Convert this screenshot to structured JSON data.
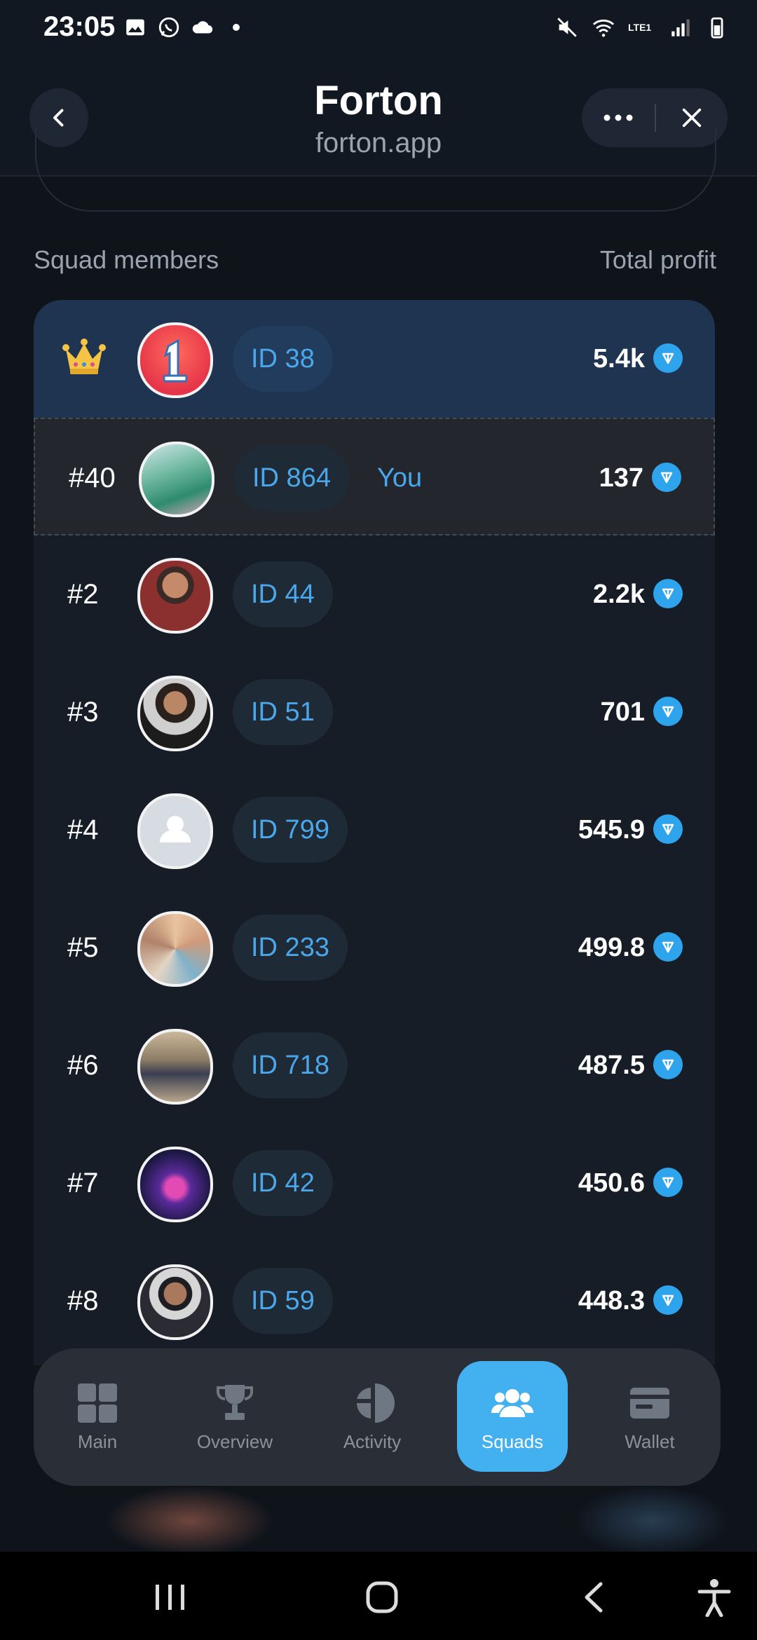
{
  "status_bar": {
    "time": "23:05",
    "network": "LTE1"
  },
  "header": {
    "title": "Forton",
    "subtitle": "forton.app"
  },
  "section": {
    "left_label": "Squad members",
    "right_label": "Total profit"
  },
  "members": [
    {
      "rank": "",
      "id": "ID 38",
      "profit": "5.4k",
      "you": "",
      "highlight": "first"
    },
    {
      "rank": "#40",
      "id": "ID 864",
      "profit": "137",
      "you": "You",
      "highlight": "you"
    },
    {
      "rank": "#2",
      "id": "ID 44",
      "profit": "2.2k",
      "you": ""
    },
    {
      "rank": "#3",
      "id": "ID 51",
      "profit": "701",
      "you": ""
    },
    {
      "rank": "#4",
      "id": "ID 799",
      "profit": "545.9",
      "you": ""
    },
    {
      "rank": "#5",
      "id": "ID 233",
      "profit": "499.8",
      "you": ""
    },
    {
      "rank": "#6",
      "id": "ID 718",
      "profit": "487.5",
      "you": ""
    },
    {
      "rank": "#7",
      "id": "ID 42",
      "profit": "450.6",
      "you": ""
    },
    {
      "rank": "#8",
      "id": "ID 59",
      "profit": "448.3",
      "you": ""
    }
  ],
  "nav": {
    "items": [
      {
        "label": "Main",
        "icon": "grid-icon"
      },
      {
        "label": "Overview",
        "icon": "trophy-icon"
      },
      {
        "label": "Activity",
        "icon": "pie-chart-icon"
      },
      {
        "label": "Squads",
        "icon": "users-icon",
        "active": true
      },
      {
        "label": "Wallet",
        "icon": "wallet-icon"
      }
    ]
  },
  "colors": {
    "accent": "#43b0f0",
    "id_text": "#4aa7ea",
    "ton": "#2ea4ec",
    "background": "#0f141b"
  }
}
